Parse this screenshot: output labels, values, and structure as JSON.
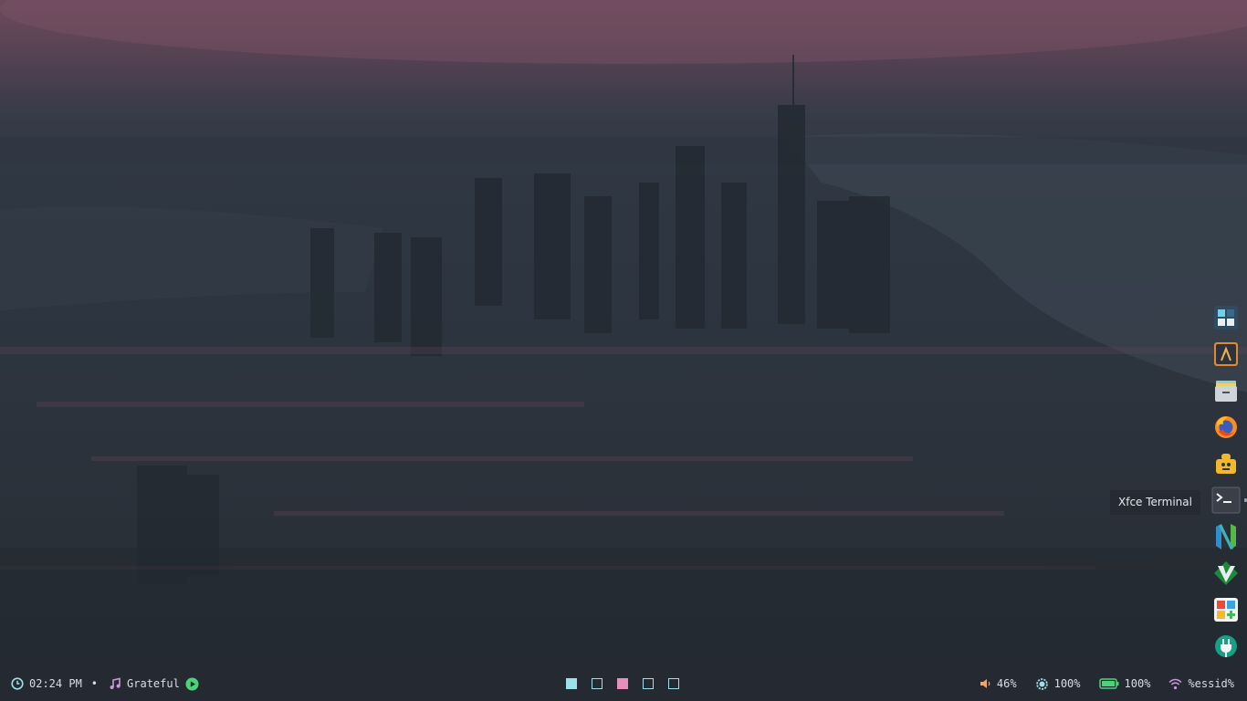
{
  "bar": {
    "left": {
      "clock_icon": "clock-icon",
      "time": "02:24 PM",
      "separator": "•",
      "music_icon": "music-note-icon",
      "track": "Grateful",
      "play_icon": "play-icon"
    },
    "workspaces": [
      {
        "name": "workspace-1",
        "state": "occupied",
        "color": "#9ee0e7"
      },
      {
        "name": "workspace-2",
        "state": "empty",
        "color": "#9ee0e7"
      },
      {
        "name": "workspace-3",
        "state": "focused",
        "color": "#e58fbd"
      },
      {
        "name": "workspace-4",
        "state": "empty",
        "color": "#9ee0e7"
      },
      {
        "name": "workspace-5",
        "state": "empty",
        "color": "#9ee0e7"
      }
    ],
    "right": {
      "volume_icon": "volume-icon",
      "volume": "46%",
      "brightness_icon": "brightness-icon",
      "brightness": "100%",
      "battery_icon": "battery-icon",
      "battery": "100%",
      "wifi_icon": "wifi-icon",
      "network": "%essid%"
    }
  },
  "dock": {
    "items": [
      {
        "icon": "app-grid-icon"
      },
      {
        "icon": "lambda-editor-icon"
      },
      {
        "icon": "file-archive-icon"
      },
      {
        "icon": "firefox-icon"
      },
      {
        "icon": "toolbox-icon"
      },
      {
        "icon": "terminal-icon",
        "running": true
      },
      {
        "icon": "neovim-icon"
      },
      {
        "icon": "vim-icon"
      },
      {
        "icon": "software-center-icon"
      },
      {
        "icon": "plug-icon"
      }
    ],
    "tooltip": "Xfce Terminal"
  },
  "colors": {
    "bar_bg": "#252a32",
    "bar_text": "#d9dde4",
    "accent_cyan": "#9ee0e7",
    "accent_pink": "#e58fbd",
    "accent_green": "#4fd17a"
  }
}
